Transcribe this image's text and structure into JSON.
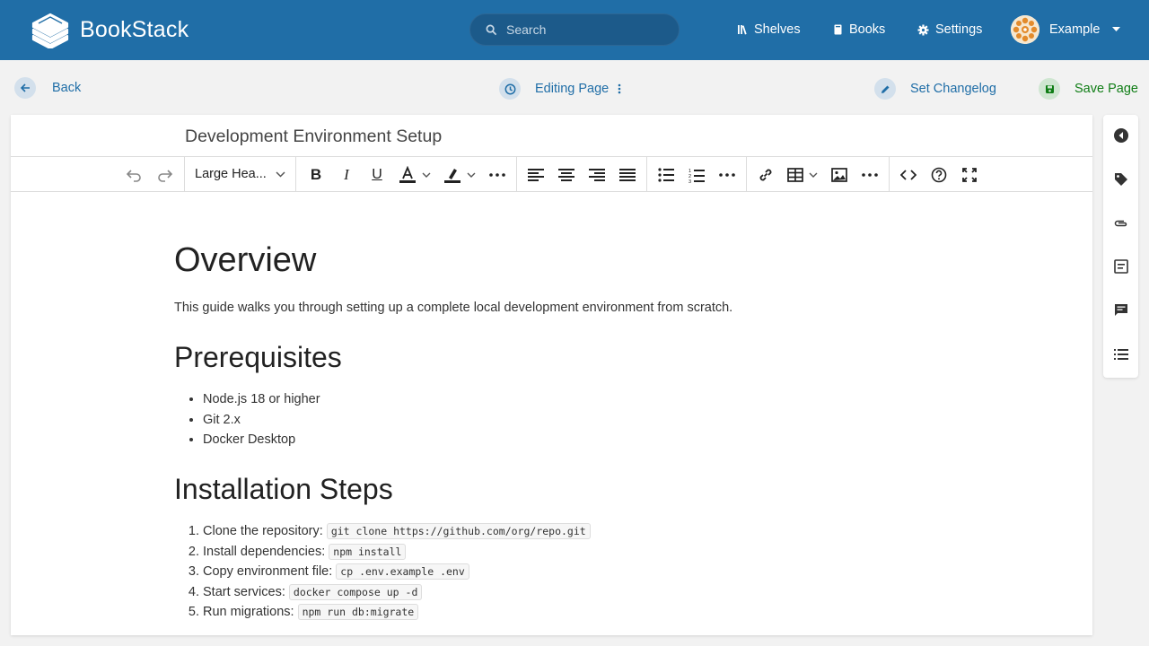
{
  "header": {
    "brand": "BookStack",
    "search_placeholder": "Search",
    "nav": {
      "shelves": "Shelves",
      "books": "Books",
      "settings": "Settings"
    },
    "user_name": "Example",
    "colors": {
      "bar": "#206ea7",
      "search_bg": "#1c5a8a"
    }
  },
  "toolbar_row": {
    "back": "Back",
    "editing": "Editing Page",
    "changelog": "Set Changelog",
    "save": "Save Page",
    "colors": {
      "link": "#206ea7",
      "save": "#0f7d15"
    }
  },
  "editor": {
    "page_title": "Development Environment Setup",
    "format_select": "Large Hea...",
    "toolbar_icons": [
      "undo-icon",
      "redo-icon",
      "bold-icon",
      "italic-icon",
      "underline-icon",
      "text-color-icon",
      "highlight-icon",
      "more-icon",
      "align-left-icon",
      "align-center-icon",
      "align-right-icon",
      "justify-icon",
      "bullet-list-icon",
      "numbered-list-icon",
      "more-icon",
      "link-icon",
      "table-icon",
      "image-icon",
      "more-icon",
      "code-icon",
      "help-icon",
      "fullscreen-icon"
    ]
  },
  "content": {
    "h_overview": "Overview",
    "intro": "This guide walks you through setting up a complete local development environment from scratch.",
    "h_prereq": "Prerequisites",
    "prereq_items": [
      "Node.js 18 or higher",
      "Git 2.x",
      "Docker Desktop"
    ],
    "h_install": "Installation Steps",
    "steps": [
      {
        "text": "Clone the repository: ",
        "code": "git clone https://github.com/org/repo.git"
      },
      {
        "text": "Install dependencies: ",
        "code": "npm install"
      },
      {
        "text": "Copy environment file: ",
        "code": "cp .env.example .env"
      },
      {
        "text": "Start services: ",
        "code": "docker compose up -d"
      },
      {
        "text": "Run migrations: ",
        "code": "npm run db:migrate"
      }
    ]
  },
  "sidebar_icons": [
    "collapse-left-icon",
    "tag-icon",
    "attachment-icon",
    "templates-icon",
    "comments-icon",
    "contents-icon"
  ]
}
